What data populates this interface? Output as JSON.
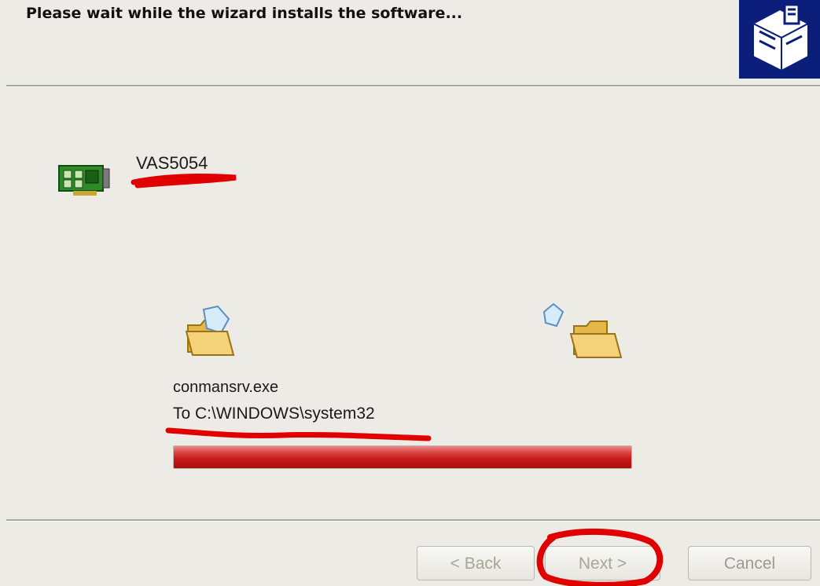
{
  "header": {
    "title": "Please wait while the wizard installs the software...",
    "logo_icon": "hardware-install-icon"
  },
  "device": {
    "icon": "network-card-icon",
    "name": "VAS5054"
  },
  "copy": {
    "source_icon": "folder-with-file-icon",
    "dest_icon": "open-folder-icon",
    "file_name": "conmansrv.exe",
    "destination": "To C:\\WINDOWS\\system32",
    "progress": 1.0,
    "progress_color": "#c81818"
  },
  "buttons": {
    "back_label": "< Back",
    "next_label": "Next >",
    "cancel_label": "Cancel"
  },
  "annotation_color": "#e00000"
}
